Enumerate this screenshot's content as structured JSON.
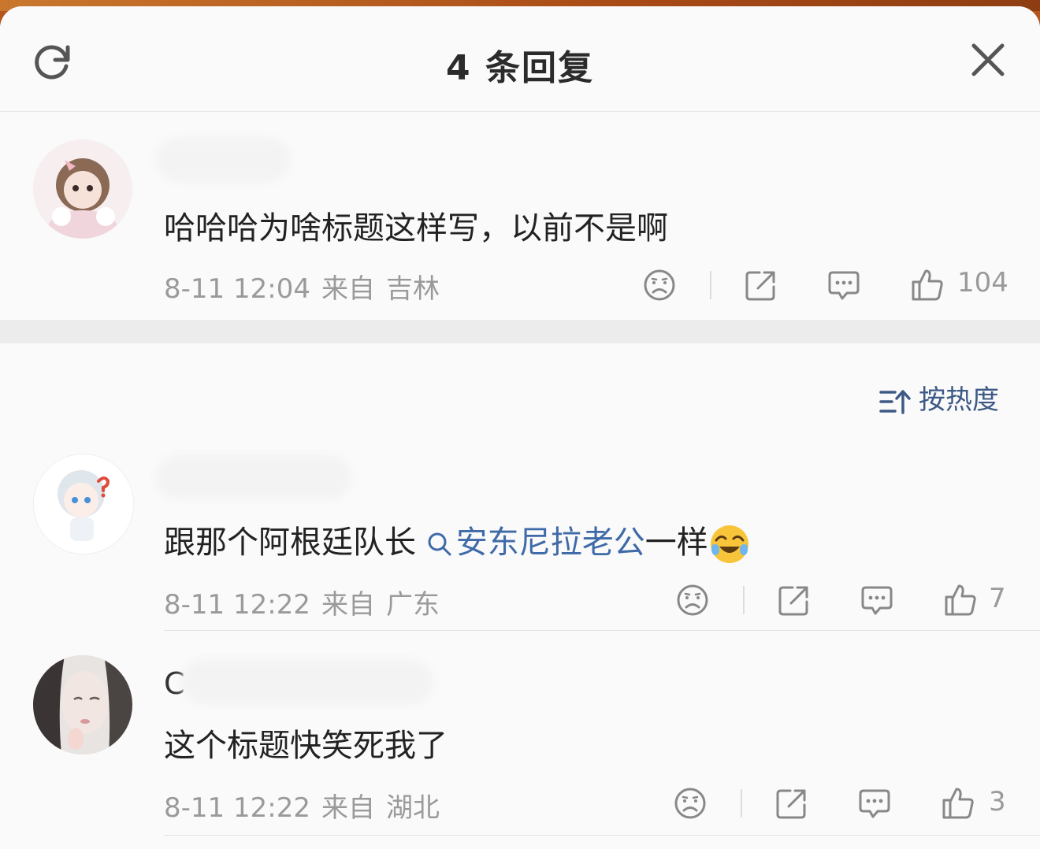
{
  "header": {
    "title": "4 条回复",
    "refresh_icon": "refresh-icon",
    "close_icon": "close-icon"
  },
  "main_comment": {
    "username": "",
    "text": "哈哈哈为啥标题这样写，以前不是啊",
    "date": "8-11 12:04",
    "from_label": "来自",
    "location": "吉林",
    "likes": "104"
  },
  "sort": {
    "label": "按热度",
    "icon": "sort-icon"
  },
  "replies": [
    {
      "username": "",
      "text_prefix": "跟那个阿根廷队长",
      "link_text": "安东尼拉老公",
      "text_suffix": "一样",
      "emoji": "laughing-crying-emoji",
      "date": "8-11 12:22",
      "from_label": "来自",
      "location": "广东",
      "likes": "7"
    },
    {
      "username": "C",
      "text": "这个标题快笑死我了",
      "date": "8-11 12:22",
      "from_label": "来自",
      "location": "湖北",
      "likes": "3"
    }
  ],
  "colors": {
    "link": "#3f6aa8",
    "meta": "#9a9a9a",
    "text": "#222222",
    "background": "#fafafa"
  }
}
